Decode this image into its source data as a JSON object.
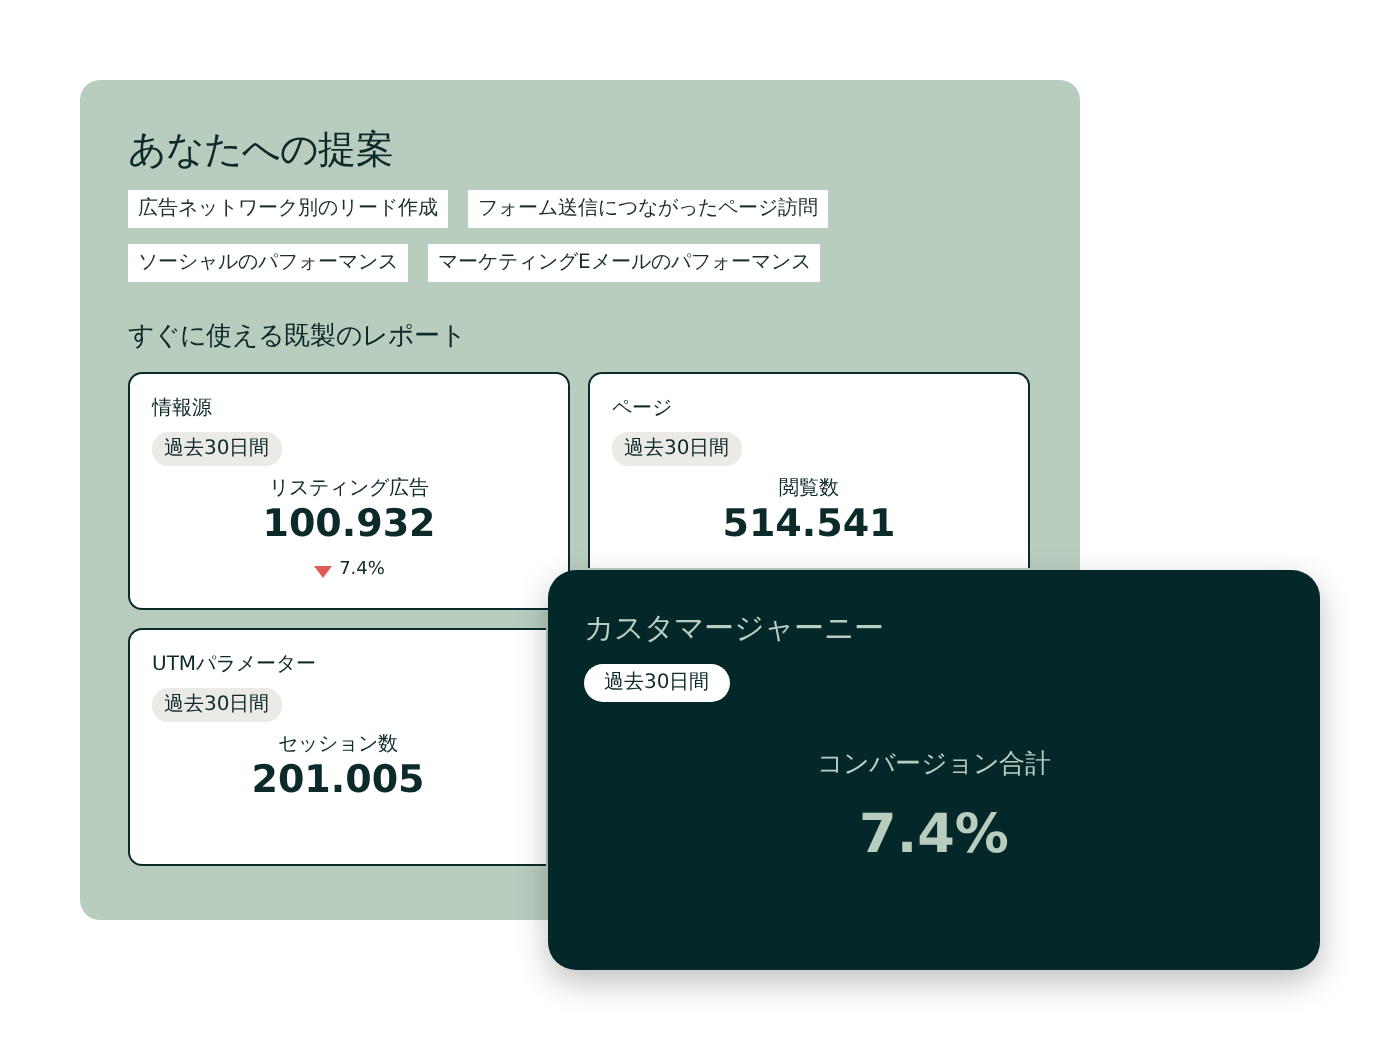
{
  "panel": {
    "title": "あなたへの提案",
    "suggestions": [
      "広告ネットワーク別のリード作成",
      "フォーム送信につながったページ訪問",
      "ソーシャルのパフォーマンス",
      "マーケティングEメールのパフォーマンス"
    ],
    "subtitle": "すぐに使える既製のレポート",
    "cards": [
      {
        "title": "情報源",
        "period": "過去30日間",
        "metric": "リスティング広告",
        "value": "100.932",
        "trend": {
          "kind": "down",
          "text": "7.4%"
        }
      },
      {
        "title": "ページ",
        "period": "過去30日間",
        "metric": "閲覧数",
        "value": "514.541"
      },
      {
        "title": "UTMパラメーター",
        "period": "過去30日間",
        "metric": "セッション数",
        "value": "201.005"
      }
    ]
  },
  "overlay_card": {
    "title": "カスタマージャーニー",
    "period": "過去30日間",
    "metric": "コンバージョン合計",
    "value": "7.4%"
  }
}
